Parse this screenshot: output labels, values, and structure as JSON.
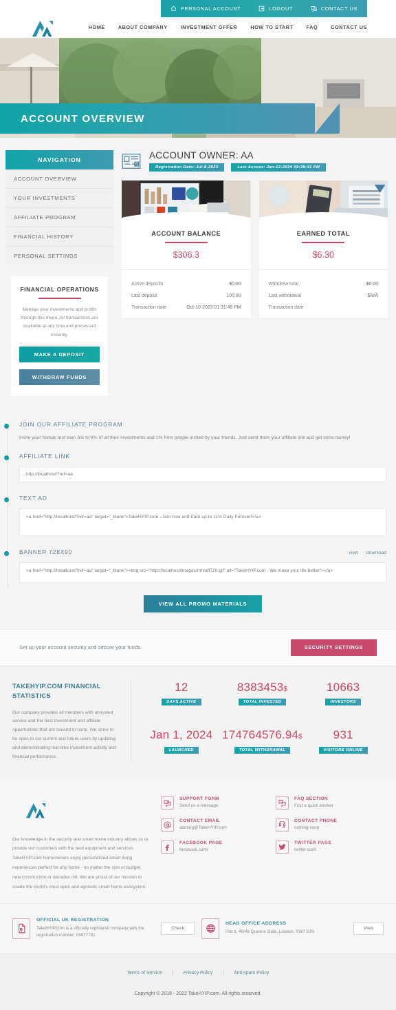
{
  "topbar": {
    "items": [
      {
        "label": "PERSONAL ACCOUNT",
        "icon": "home-icon"
      },
      {
        "label": "LOGOUT",
        "icon": "logout-icon"
      },
      {
        "label": "CONTACT US",
        "icon": "chat-icon"
      }
    ]
  },
  "mainnav": {
    "items": [
      {
        "label": "HOME"
      },
      {
        "label": "ABOUT COMPANY"
      },
      {
        "label": "INVESTMENT OFFER"
      },
      {
        "label": "HOW TO START"
      },
      {
        "label": "FAQ"
      },
      {
        "label": "CONTACT US"
      }
    ]
  },
  "hero": {
    "title": "ACCOUNT OVERVIEW"
  },
  "sidebar": {
    "heading": "NAVIGATION",
    "items": [
      {
        "label": "ACCOUNT OVERVIEW"
      },
      {
        "label": "YOUR INVESTMENTS"
      },
      {
        "label": "AFFILIATE PROGRAM"
      },
      {
        "label": "FINANCIAL HISTORY"
      },
      {
        "label": "PERSONAL SETTINGS"
      }
    ],
    "finops": {
      "title": "FINANCIAL OPERATIONS",
      "text": "Manage your investments and profits through this menu. All transactions are available at any time and processed instantly.",
      "deposit_label": "MAKE A DEPOSIT",
      "withdraw_label": "WITHDRAW FUNDS"
    }
  },
  "account": {
    "owner_title": "ACCOUNT OWNER: AA",
    "registration_badge": "Registration Date: Jul-8-2023",
    "last_access_badge": "Last Access: Jan-12-2024 09:39:31 PM",
    "cards": [
      {
        "title": "ACCOUNT BALANCE",
        "amount": "$306.3",
        "rows": [
          {
            "label": "Active deposits",
            "value": "$0.00"
          },
          {
            "label": "Last deposit",
            "value": "100.00"
          },
          {
            "label": "Transaction date",
            "value": "Oct-10-2023 01:31:48 PM"
          }
        ]
      },
      {
        "title": "EARNED TOTAL",
        "amount": "$6.30",
        "rows": [
          {
            "label": "Withdrew total",
            "value": "$0.00"
          },
          {
            "label": "Last withdrawal",
            "value": "$N/A"
          },
          {
            "label": "Transaction date",
            "value": ""
          }
        ]
      }
    ]
  },
  "affiliate": {
    "program_title": "JOIN OUR AFFILIATE PROGRAM",
    "program_desc": "Invite your friends and earn 6% to 9% of all their investments and 1% from people invited by your friends. Just send them your affiliate link and get extra money!",
    "link_title": "AFFILIATE LINK",
    "link_value": "http://localhost/?ref=aa",
    "textad_title": "TEXT AD",
    "textad_value": "<a href=\"http://localhost/?ref=aa\" target=\"_blank\">TakeHYIP.com - Join now and Earn up to 11% Daily Forever!</a>",
    "banner_title": "BANNER 728X90",
    "banner_view": "view",
    "banner_download": "download",
    "banner_value": "<a href=\"http://localhost/?ref=aa\" target=\"_blank\"><img src=\"http://localhost/images/mh/aff720.gif\" alt=\"TakeHYIP.com - We make your life better\"></a>",
    "promo_button": "VIEW ALL PROMO MATERIALS"
  },
  "security": {
    "text": "Set up your account security and secure your funds.",
    "button": "SECURITY SETTINGS"
  },
  "stats": {
    "title": "TAKEHYIP.COM FINANCIAL STATISTICS",
    "desc": "Our company provides all members with unrivaled service and the best investment and affiliate opportunities that are second to none. We strive to be open to our current and future users by updating and demonstrating real-time investment activity and financial performance.",
    "items": [
      {
        "value": "12",
        "suffix": "",
        "label": "DAYS ACTIVE"
      },
      {
        "value": "8383453",
        "suffix": "$",
        "label": "TOTAL INVESTED"
      },
      {
        "value": "10663",
        "suffix": "",
        "label": "INVESTORS"
      },
      {
        "value": "Jan 1, 2024",
        "suffix": "",
        "label": "LAUNCHED"
      },
      {
        "value": "174764576.94",
        "suffix": "$",
        "label": "TOTAL WITHDRAWAL"
      },
      {
        "value": "931",
        "suffix": "",
        "label": "VISITORS ONLINE"
      }
    ]
  },
  "footer": {
    "about": "Our knowledge in the security and smart home industry allows us to provide our customers with the best equipment and services. TakeHYIP.com homeowners enjoy personalized smart living experiences perfect for any home - no matter the size or budget, new construction or decades old. We are proud of our mission to create the world's most open and agnostic smart home ecosystem.",
    "contacts": [
      {
        "title": "SUPPORT FORM",
        "sub": "Send us a message",
        "icon": "chat-bubbles-icon"
      },
      {
        "title": "FAQ SECTION",
        "sub": "Find a quick answer",
        "icon": "faq-icon"
      },
      {
        "title": "CONTACT EMAIL",
        "sub": "adming@TakeHYIP.com",
        "icon": "at-icon"
      },
      {
        "title": "CONTACT PHONE",
        "sub": "coming soon",
        "icon": "phone-icon"
      },
      {
        "title": "FACEBOOK PAGE",
        "sub": "facebook.com/",
        "icon": "facebook-icon"
      },
      {
        "title": "TWITTER PAGE",
        "sub": "twitter.com/",
        "icon": "twitter-icon"
      }
    ],
    "registration": {
      "title": "OFFICIAL UK REGISTRATION",
      "sub": "TakeHYIP.com is a officially registered company with the registration number: 05077791",
      "button": "Check"
    },
    "address": {
      "title": "HEAD OFFICE ADDRESS",
      "sub": "Flat 6, 48/49 Queens Gate, London, SW7 5JN",
      "button": "View"
    },
    "links": [
      {
        "label": "Terms of Service"
      },
      {
        "label": "Privacy Policy"
      },
      {
        "label": "Anti-spam Policy"
      }
    ],
    "copyright": "Copyright © 2018 - 2022 TakeHYIP.com. All rights reserved."
  },
  "colors": {
    "teal": "#16a3a8",
    "blue": "#3f9bb2",
    "pink": "#c84b63",
    "crimson": "#c84b6e"
  }
}
